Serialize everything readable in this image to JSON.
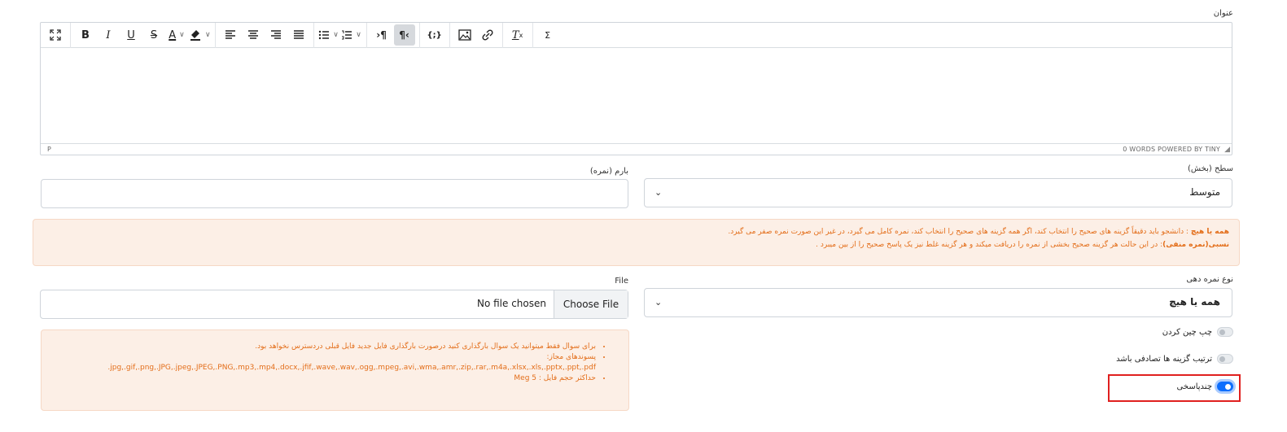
{
  "editor": {
    "label": "عنوان",
    "status_path": "P",
    "status_right": "0 WORDS  POWERED BY TINY",
    "toolbar": {
      "fullscreen": "⛶",
      "bold": "B",
      "italic": "I",
      "underline": "U",
      "strikethrough": "S",
      "text_color": "A",
      "highlight": "🖍",
      "align_left": "≡",
      "align_center": "≡",
      "align_right": "≡",
      "justify": "≡",
      "bullet_list": "☰",
      "numbered_list": "☰",
      "ltr": "¶",
      "rtl": "¶",
      "code": "{;}",
      "image": "🖼",
      "link": "🔗",
      "clear_format": "T",
      "sigma": "Σ"
    }
  },
  "level": {
    "label": "سطح (بخش)",
    "value": "متوسط"
  },
  "score": {
    "label": "بارم (نمره)",
    "value": ""
  },
  "info_alert": {
    "line1_bold": "همه یا هیچ",
    "line1_text": " : دانشجو باید دقیقاً گزینه های صحیح را انتخاب کند، اگر همه گزینه های صحیح را انتخاب کند، نمره کامل می گیرد، در غیر این صورت نمره صفر می گیرد.",
    "line2_bold": "نسبی(نمره منفی)",
    "line2_text": ": در این حالت هر گزینه صحیح بخشی از نمره را دریافت میکند و هر گزینه غلط نیز یک پاسخ صحیح را از بین میبرد ."
  },
  "grading": {
    "label": "نوع نمره دهی",
    "value": "همه یا هیچ"
  },
  "file": {
    "label": "File",
    "button": "Choose File",
    "status": "No file chosen"
  },
  "file_alert": {
    "items": [
      "برای سوال فقط میتوانید یک سوال بارگذاری کنید درصورت بارگذاری فایل جدید فایل قبلی دردسترس نخواهد بود.",
      "پسوندهای مجاز:",
      "jpg,.gif,.png,.JPG,.jpeg,.JPEG,.PNG,.mp3,.mp4,.docx,.jfif,.wave,.wav,.ogg,.mpeg,.avi,.wma,.amr,.zip,.rar,.m4a,.xlsx,.xls,.pptx,.ppt,.pdf.",
      "حداکثر حجم فایل : 5 Meg"
    ]
  },
  "toggles": {
    "rtl_layout": {
      "label": "چپ چین کردن",
      "on": false
    },
    "shuffle": {
      "label": "ترتیب گزینه ها تصادفی باشد",
      "on": false
    },
    "multi_answer": {
      "label": "چندپاسخی",
      "on": true
    }
  },
  "colors": {
    "alert_bg": "#fcefe6",
    "alert_text": "#e36e1a",
    "toggle_on": "#0d6efd",
    "highlight_border": "#e0201f"
  }
}
